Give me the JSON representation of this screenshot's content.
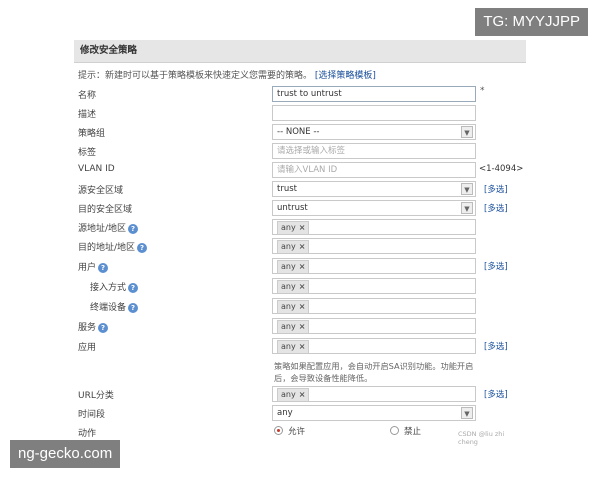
{
  "watermarks": {
    "top": "TG: MYYJJPP",
    "bottom": "ng-gecko.com"
  },
  "header": {
    "title": "修改安全策略"
  },
  "hint": {
    "text": "提示：新建时可以基于策略模板来快速定义您需要的策略。",
    "link": "[选择策略模板]"
  },
  "fields": {
    "name": {
      "label": "名称",
      "value": "trust to untrust",
      "required": "*"
    },
    "description": {
      "label": "描述",
      "value": ""
    },
    "policy_group": {
      "label": "策略组",
      "value": "-- NONE --"
    },
    "tag": {
      "label": "标签",
      "placeholder": "请选择或输入标签"
    },
    "vlan": {
      "label": "VLAN ID",
      "placeholder": "请输入VLAN ID",
      "range": "<1-4094>"
    },
    "src_zone": {
      "label": "源安全区域",
      "value": "trust",
      "multi": "[多选]"
    },
    "dst_zone": {
      "label": "目的安全区域",
      "value": "untrust",
      "multi": "[多选]"
    },
    "src_addr": {
      "label": "源地址/地区",
      "tag": "any"
    },
    "dst_addr": {
      "label": "目的地址/地区",
      "tag": "any"
    },
    "user": {
      "label": "用户",
      "tag": "any",
      "multi": "[多选]"
    },
    "access_mode": {
      "label": "接入方式",
      "tag": "any"
    },
    "terminal": {
      "label": "终端设备",
      "tag": "any"
    },
    "service": {
      "label": "服务",
      "tag": "any"
    },
    "application": {
      "label": "应用",
      "tag": "any",
      "multi": "[多选]"
    },
    "url": {
      "label": "URL分类",
      "tag": "any",
      "multi": "[多选]"
    },
    "time": {
      "label": "时间段",
      "value": "any"
    },
    "action": {
      "label": "动作",
      "allow": "允许",
      "deny": "禁止",
      "selected": "允许"
    }
  },
  "note": "策略如果配置应用，会自动开启SA识别功能。功能开启后，会导致设备性能降低。",
  "credit": "CSDN @liu zhi cheng",
  "icons": {
    "help": "question-icon",
    "dropdown": "chevron-down-icon",
    "remove": "close-icon"
  }
}
